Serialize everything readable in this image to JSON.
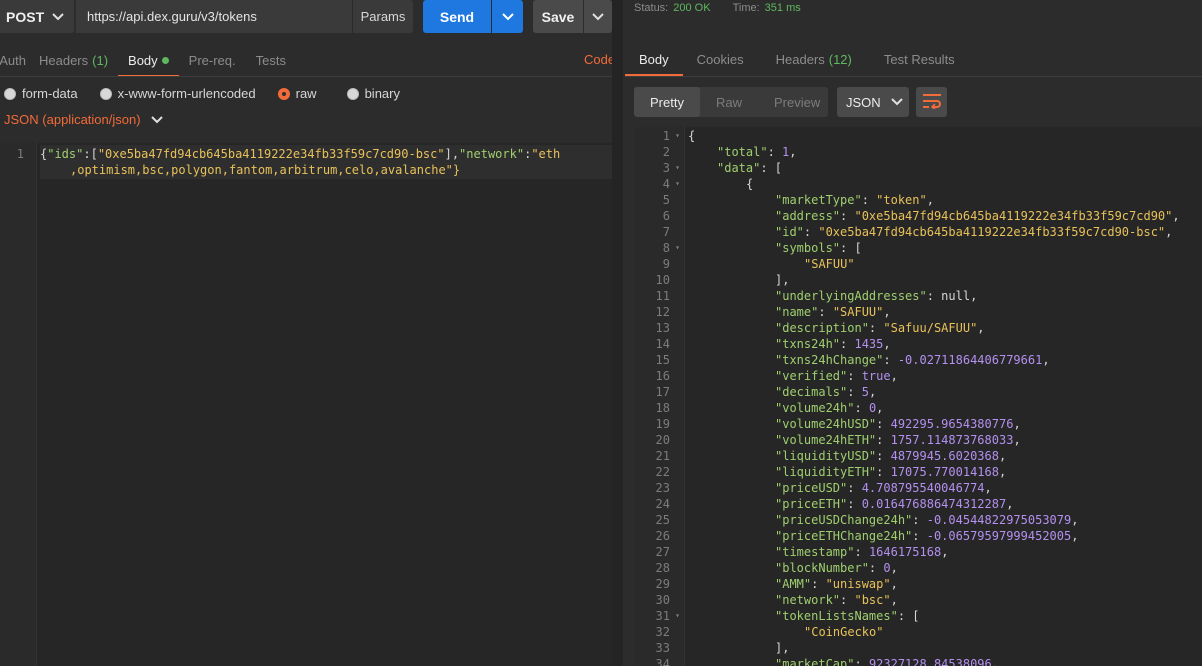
{
  "request": {
    "method": "POST",
    "url": "https://api.dex.guru/v3/tokens",
    "params_label": "Params",
    "send_label": "Send",
    "save_label": "Save",
    "tabs": [
      {
        "label": "Auth",
        "count": ""
      },
      {
        "label": "Headers",
        "count": "(1)"
      },
      {
        "label": "Body",
        "count": ""
      },
      {
        "label": "Pre-req.",
        "count": ""
      },
      {
        "label": "Tests",
        "count": ""
      }
    ],
    "code_label": "Code",
    "body_modes": [
      "form-data",
      "x-www-form-urlencoded",
      "raw",
      "binary"
    ],
    "content_type": "JSON (application/json)",
    "line_number": "1",
    "body_line1": [
      "{",
      "\"ids\"",
      ":[",
      "\"0xe5ba47fd94cb645ba4119222e34fb33f59c7cd90-bsc\"",
      "],",
      "\"network\"",
      ":",
      "\"eth"
    ],
    "body_line2": ",optimism,bsc,polygon,fantom,arbitrum,celo,avalanche\"}"
  },
  "response": {
    "status_label": "Status:",
    "status_value": "200 OK",
    "time_label": "Time:",
    "time_value": "351 ms",
    "tabs": [
      {
        "label": "Body",
        "count": ""
      },
      {
        "label": "Cookies",
        "count": ""
      },
      {
        "label": "Headers",
        "count": "(12)"
      },
      {
        "label": "Test Results",
        "count": ""
      }
    ],
    "view_modes": [
      "Pretty",
      "Raw",
      "Preview"
    ],
    "format": "JSON",
    "lines": [
      {
        "n": "1",
        "fold": true,
        "indent": 0,
        "parts": [
          [
            "p",
            "{"
          ]
        ]
      },
      {
        "n": "2",
        "indent": 1,
        "parts": [
          [
            "k",
            "\"total\""
          ],
          [
            "p",
            ": "
          ],
          [
            "num",
            "1"
          ],
          [
            "p",
            ","
          ]
        ]
      },
      {
        "n": "3",
        "fold": true,
        "indent": 1,
        "parts": [
          [
            "k",
            "\"data\""
          ],
          [
            "p",
            ": ["
          ]
        ]
      },
      {
        "n": "4",
        "fold": true,
        "indent": 2,
        "parts": [
          [
            "p",
            "{"
          ]
        ]
      },
      {
        "n": "5",
        "indent": 3,
        "parts": [
          [
            "k",
            "\"marketType\""
          ],
          [
            "p",
            ": "
          ],
          [
            "s",
            "\"token\""
          ],
          [
            "p",
            ","
          ]
        ]
      },
      {
        "n": "6",
        "indent": 3,
        "parts": [
          [
            "k",
            "\"address\""
          ],
          [
            "p",
            ": "
          ],
          [
            "s",
            "\"0xe5ba47fd94cb645ba4119222e34fb33f59c7cd90\""
          ],
          [
            "p",
            ","
          ]
        ]
      },
      {
        "n": "7",
        "indent": 3,
        "parts": [
          [
            "k",
            "\"id\""
          ],
          [
            "p",
            ": "
          ],
          [
            "s",
            "\"0xe5ba47fd94cb645ba4119222e34fb33f59c7cd90-bsc\""
          ],
          [
            "p",
            ","
          ]
        ]
      },
      {
        "n": "8",
        "fold": true,
        "indent": 3,
        "parts": [
          [
            "k",
            "\"symbols\""
          ],
          [
            "p",
            ": ["
          ]
        ]
      },
      {
        "n": "9",
        "indent": 4,
        "parts": [
          [
            "s",
            "\"SAFUU\""
          ]
        ]
      },
      {
        "n": "10",
        "indent": 3,
        "parts": [
          [
            "p",
            "],"
          ]
        ]
      },
      {
        "n": "11",
        "indent": 3,
        "parts": [
          [
            "k",
            "\"underlyingAddresses\""
          ],
          [
            "p",
            ": null,"
          ]
        ]
      },
      {
        "n": "12",
        "indent": 3,
        "parts": [
          [
            "k",
            "\"name\""
          ],
          [
            "p",
            ": "
          ],
          [
            "s",
            "\"SAFUU\""
          ],
          [
            "p",
            ","
          ]
        ]
      },
      {
        "n": "13",
        "indent": 3,
        "parts": [
          [
            "k",
            "\"description\""
          ],
          [
            "p",
            ": "
          ],
          [
            "s",
            "\"Safuu/SAFUU\""
          ],
          [
            "p",
            ","
          ]
        ]
      },
      {
        "n": "14",
        "indent": 3,
        "parts": [
          [
            "k",
            "\"txns24h\""
          ],
          [
            "p",
            ": "
          ],
          [
            "num",
            "1435"
          ],
          [
            "p",
            ","
          ]
        ]
      },
      {
        "n": "15",
        "indent": 3,
        "parts": [
          [
            "k",
            "\"txns24hChange\""
          ],
          [
            "p",
            ": "
          ],
          [
            "num",
            "-0.02711864406779661"
          ],
          [
            "p",
            ","
          ]
        ]
      },
      {
        "n": "16",
        "indent": 3,
        "parts": [
          [
            "k",
            "\"verified\""
          ],
          [
            "p",
            ": "
          ],
          [
            "lit",
            "true"
          ],
          [
            "p",
            ","
          ]
        ]
      },
      {
        "n": "17",
        "indent": 3,
        "parts": [
          [
            "k",
            "\"decimals\""
          ],
          [
            "p",
            ": "
          ],
          [
            "num",
            "5"
          ],
          [
            "p",
            ","
          ]
        ]
      },
      {
        "n": "18",
        "indent": 3,
        "parts": [
          [
            "k",
            "\"volume24h\""
          ],
          [
            "p",
            ": "
          ],
          [
            "num",
            "0"
          ],
          [
            "p",
            ","
          ]
        ]
      },
      {
        "n": "19",
        "indent": 3,
        "parts": [
          [
            "k",
            "\"volume24hUSD\""
          ],
          [
            "p",
            ": "
          ],
          [
            "num",
            "492295.9654380776"
          ],
          [
            "p",
            ","
          ]
        ]
      },
      {
        "n": "20",
        "indent": 3,
        "parts": [
          [
            "k",
            "\"volume24hETH\""
          ],
          [
            "p",
            ": "
          ],
          [
            "num",
            "1757.114873768033"
          ],
          [
            "p",
            ","
          ]
        ]
      },
      {
        "n": "21",
        "indent": 3,
        "parts": [
          [
            "k",
            "\"liquidityUSD\""
          ],
          [
            "p",
            ": "
          ],
          [
            "num",
            "4879945.6020368"
          ],
          [
            "p",
            ","
          ]
        ]
      },
      {
        "n": "22",
        "indent": 3,
        "parts": [
          [
            "k",
            "\"liquidityETH\""
          ],
          [
            "p",
            ": "
          ],
          [
            "num",
            "17075.770014168"
          ],
          [
            "p",
            ","
          ]
        ]
      },
      {
        "n": "23",
        "indent": 3,
        "parts": [
          [
            "k",
            "\"priceUSD\""
          ],
          [
            "p",
            ": "
          ],
          [
            "num",
            "4.708795540046774"
          ],
          [
            "p",
            ","
          ]
        ]
      },
      {
        "n": "24",
        "indent": 3,
        "parts": [
          [
            "k",
            "\"priceETH\""
          ],
          [
            "p",
            ": "
          ],
          [
            "num",
            "0.016476886474312287"
          ],
          [
            "p",
            ","
          ]
        ]
      },
      {
        "n": "25",
        "indent": 3,
        "parts": [
          [
            "k",
            "\"priceUSDChange24h\""
          ],
          [
            "p",
            ": "
          ],
          [
            "num",
            "-0.04544822975053079"
          ],
          [
            "p",
            ","
          ]
        ]
      },
      {
        "n": "26",
        "indent": 3,
        "parts": [
          [
            "k",
            "\"priceETHChange24h\""
          ],
          [
            "p",
            ": "
          ],
          [
            "num",
            "-0.06579597999452005"
          ],
          [
            "p",
            ","
          ]
        ]
      },
      {
        "n": "27",
        "indent": 3,
        "parts": [
          [
            "k",
            "\"timestamp\""
          ],
          [
            "p",
            ": "
          ],
          [
            "num",
            "1646175168"
          ],
          [
            "p",
            ","
          ]
        ]
      },
      {
        "n": "28",
        "indent": 3,
        "parts": [
          [
            "k",
            "\"blockNumber\""
          ],
          [
            "p",
            ": "
          ],
          [
            "num",
            "0"
          ],
          [
            "p",
            ","
          ]
        ]
      },
      {
        "n": "29",
        "indent": 3,
        "parts": [
          [
            "k",
            "\"AMM\""
          ],
          [
            "p",
            ": "
          ],
          [
            "s",
            "\"uniswap\""
          ],
          [
            "p",
            ","
          ]
        ]
      },
      {
        "n": "30",
        "indent": 3,
        "parts": [
          [
            "k",
            "\"network\""
          ],
          [
            "p",
            ": "
          ],
          [
            "s",
            "\"bsc\""
          ],
          [
            "p",
            ","
          ]
        ]
      },
      {
        "n": "31",
        "fold": true,
        "indent": 3,
        "parts": [
          [
            "k",
            "\"tokenListsNames\""
          ],
          [
            "p",
            ": ["
          ]
        ]
      },
      {
        "n": "32",
        "indent": 4,
        "parts": [
          [
            "s",
            "\"CoinGecko\""
          ]
        ]
      },
      {
        "n": "33",
        "indent": 3,
        "parts": [
          [
            "p",
            "],"
          ]
        ]
      },
      {
        "n": "34",
        "indent": 3,
        "parts": [
          [
            "k",
            "\"marketCap\""
          ],
          [
            "p",
            ": "
          ],
          [
            "num",
            "92327128.84538096"
          ],
          [
            "p",
            ","
          ]
        ]
      }
    ]
  },
  "colors": {
    "accent": "#f26b3a",
    "send": "#1f77e0",
    "ok": "#5fb85f",
    "json_key": "#9fcf6f",
    "json_string": "#e8c15a",
    "json_number": "#b490f0"
  }
}
